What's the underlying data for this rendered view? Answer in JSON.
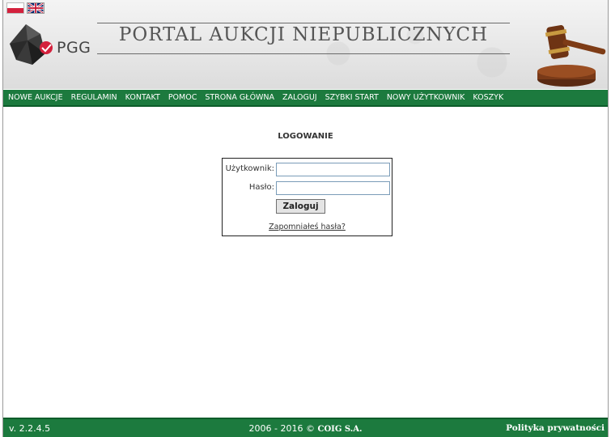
{
  "header": {
    "logo_text": "PGG",
    "portal_title": "PORTAL AUKCJI NIEPUBLICZNYCH",
    "flags": [
      "flag-pl-icon",
      "flag-en-icon"
    ]
  },
  "nav": {
    "items": [
      {
        "label": "NOWE AUKCJE"
      },
      {
        "label": "REGULAMIN"
      },
      {
        "label": "KONTAKT"
      },
      {
        "label": "POMOC"
      },
      {
        "label": "STRONA GŁÓWNA"
      },
      {
        "label": "ZALOGUJ"
      },
      {
        "label": "SZYBKI START"
      },
      {
        "label": "NOWY UŻYTKOWNIK"
      },
      {
        "label": "KOSZYK"
      }
    ]
  },
  "main": {
    "heading": "LOGOWANIE",
    "login": {
      "user_label": "Użytkownik:",
      "user_value": "",
      "pass_label": "Hasło:",
      "pass_value": "",
      "submit_label": "Zaloguj",
      "forgot_label": "Zapomniałeś hasła?"
    }
  },
  "footer": {
    "version": "v. 2.2.4.5",
    "years": "2006 - 2016 ©",
    "company": "COIG S.A.",
    "privacy_label": "Polityka prywatności"
  },
  "colors": {
    "nav_green": "#1c7a3e",
    "nav_border": "#0d5c2a"
  }
}
